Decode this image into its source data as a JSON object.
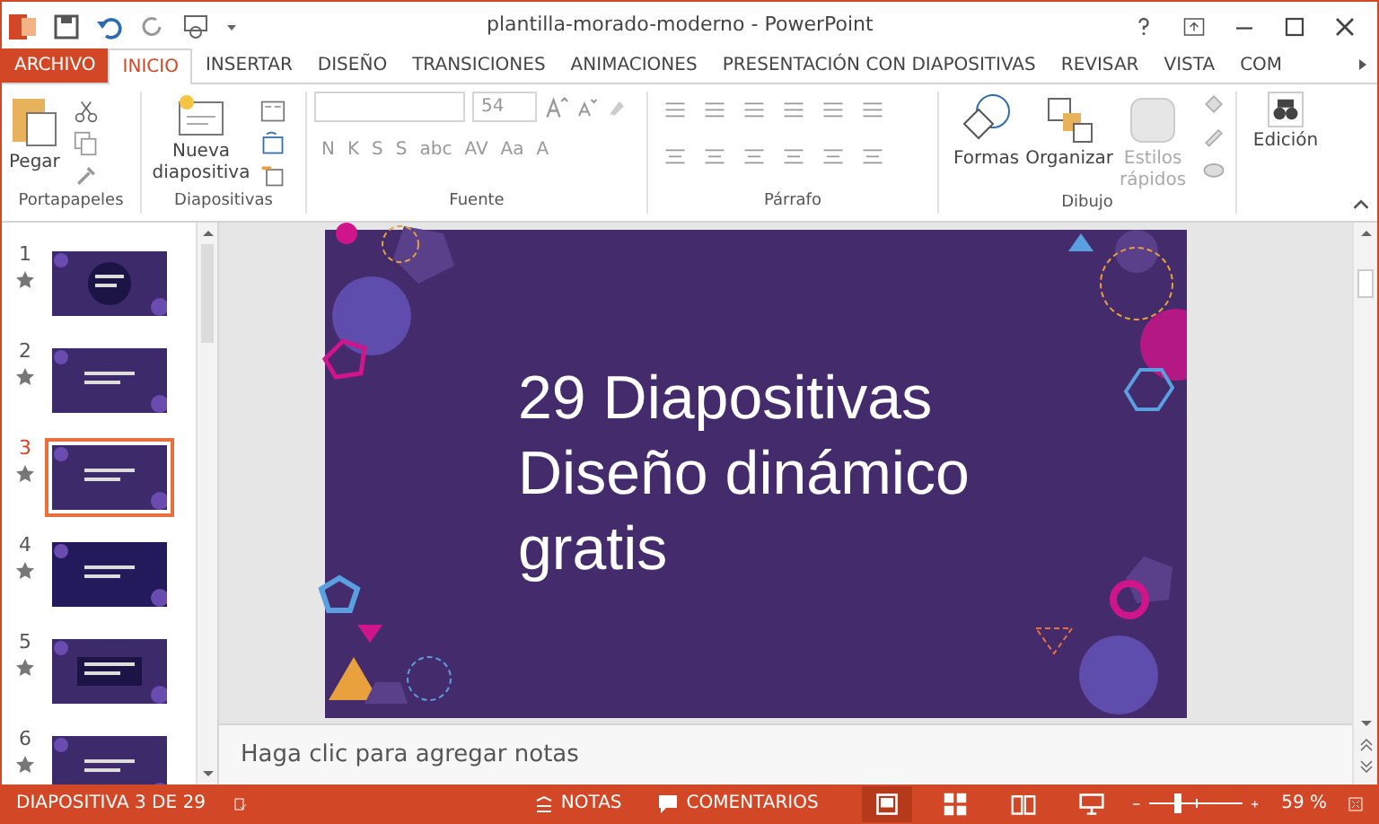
{
  "window": {
    "title": "plantilla-morado-moderno - PowerPoint"
  },
  "tabs": [
    {
      "label": "ARCHIVO",
      "kind": "file",
      "selected": false
    },
    {
      "label": "INICIO",
      "kind": "tab",
      "selected": true
    },
    {
      "label": "INSERTAR",
      "kind": "tab",
      "selected": false
    },
    {
      "label": "DISEÑO",
      "kind": "tab",
      "selected": false
    },
    {
      "label": "TRANSICIONES",
      "kind": "tab",
      "selected": false
    },
    {
      "label": "ANIMACIONES",
      "kind": "tab",
      "selected": false
    },
    {
      "label": "PRESENTACIÓN CON DIAPOSITIVAS",
      "kind": "tab",
      "selected": false
    },
    {
      "label": "REVISAR",
      "kind": "tab",
      "selected": false
    },
    {
      "label": "VISTA",
      "kind": "tab",
      "selected": false
    },
    {
      "label": "COM",
      "kind": "tab",
      "selected": false
    }
  ],
  "ribbon": {
    "clipboard": {
      "label": "Portapapeles",
      "paste": "Pegar"
    },
    "slides": {
      "label": "Diapositivas",
      "new_slide": "Nueva diapositiva"
    },
    "font": {
      "label": "Fuente",
      "size": "54",
      "buttons": [
        "N",
        "K",
        "S",
        "S",
        "abc",
        "AV",
        "Aa",
        "A"
      ]
    },
    "paragraph": {
      "label": "Párrafo"
    },
    "drawing": {
      "label": "Dibujo",
      "buttons": [
        {
          "label": "Formas",
          "disabled": false
        },
        {
          "label": "Organizar",
          "disabled": false
        },
        {
          "label": "Estilos rápidos",
          "disabled": true
        }
      ]
    },
    "editing": {
      "label": "Edición"
    }
  },
  "slides": [
    {
      "number": "1",
      "selected": false
    },
    {
      "number": "2",
      "selected": false
    },
    {
      "number": "3",
      "selected": true
    },
    {
      "number": "4",
      "selected": false
    },
    {
      "number": "5",
      "selected": false
    },
    {
      "number": "6",
      "selected": false
    }
  ],
  "slide": {
    "title_lines": [
      "29 Diapositivas",
      "Diseño dinámico",
      "gratis"
    ]
  },
  "notes": {
    "placeholder": "Haga clic para agregar notas"
  },
  "status_bar": {
    "slide_info": "DIAPOSITIVA 3 DE 29",
    "notes": "NOTAS",
    "comments": "COMENTARIOS",
    "views": [
      {
        "kind": "normal",
        "selected": true
      },
      {
        "kind": "sorter",
        "selected": false
      },
      {
        "kind": "reading",
        "selected": false
      },
      {
        "kind": "slideshow",
        "selected": false
      }
    ],
    "zoom": {
      "level": 0.32,
      "reading": "59 %"
    }
  }
}
